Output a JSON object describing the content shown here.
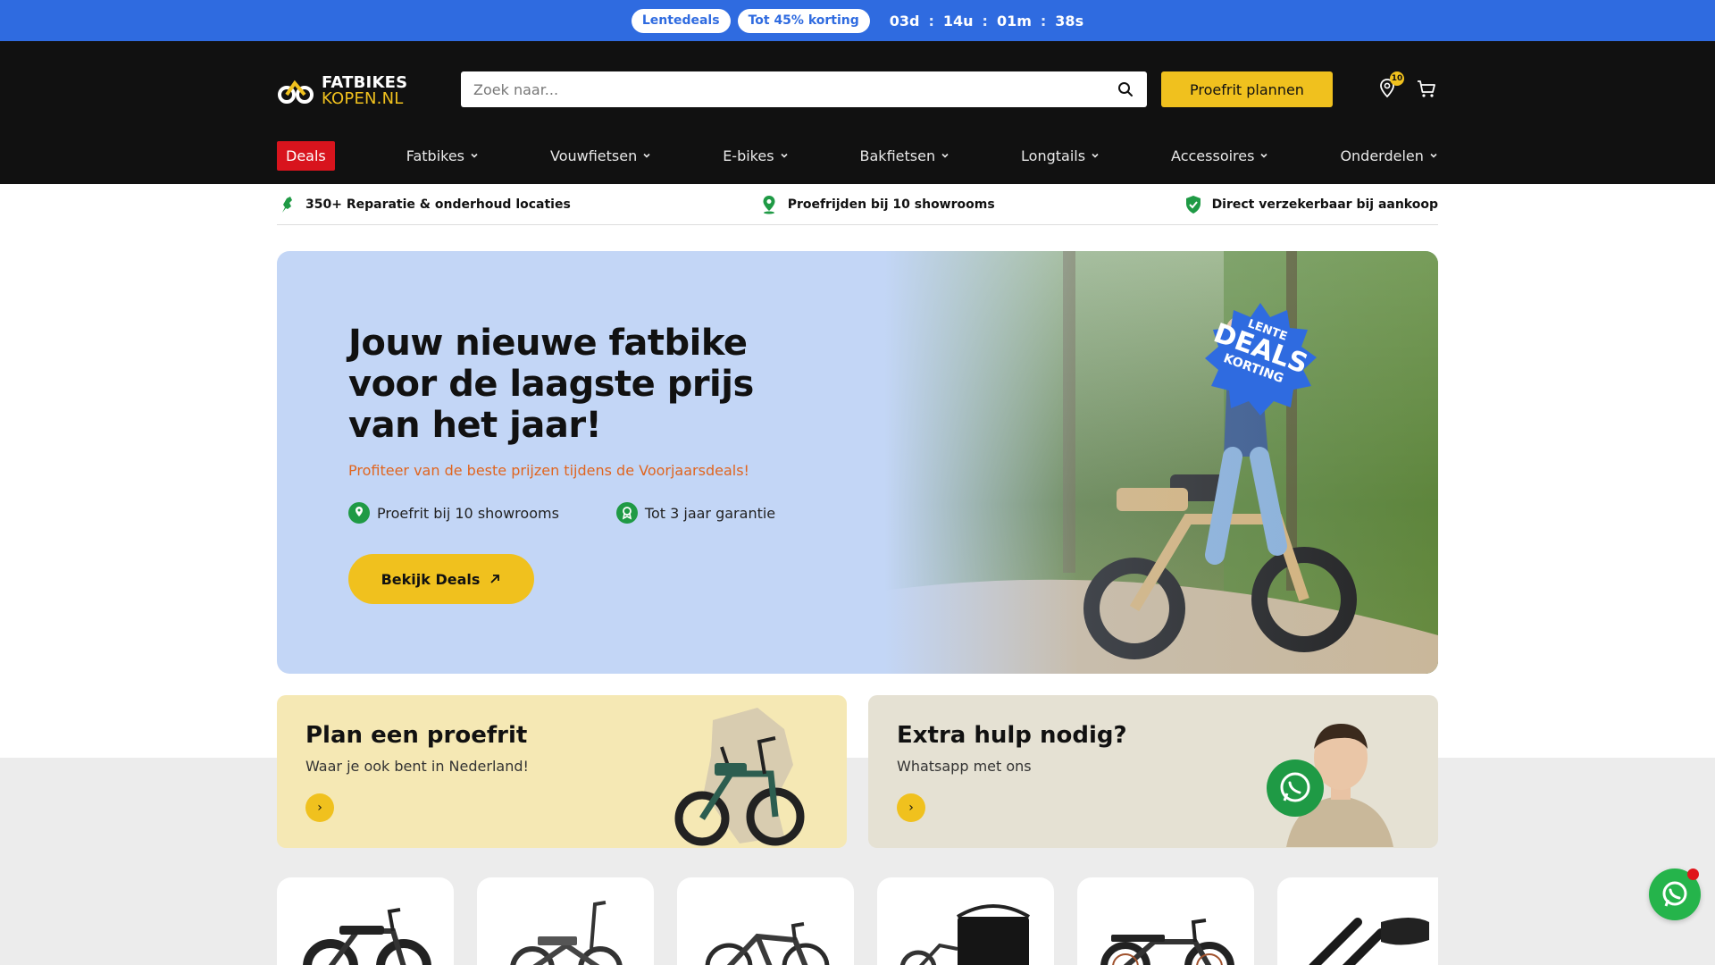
{
  "promo": {
    "pill1": "Lentedeals",
    "pill2": "Tot 45% korting",
    "days": "03d",
    "hours": "14u",
    "minutes": "01m",
    "seconds": "38s",
    "sep": ":"
  },
  "header": {
    "logo_line1": "FATBIKES",
    "logo_line2": "KOPEN.NL",
    "search_placeholder": "Zoek naar...",
    "cta": "Proefrit plannen",
    "location_badge": "10"
  },
  "nav": {
    "deals": "Deals",
    "items": [
      "Fatbikes",
      "Vouwfietsen",
      "E-bikes",
      "Bakfietsen",
      "Longtails",
      "Accessoires",
      "Onderdelen"
    ]
  },
  "usp": {
    "items": [
      "350+ Reparatie & onderhoud locaties",
      "Proefrijden bij 10 showrooms",
      "Direct verzekerbaar bij aankoop"
    ]
  },
  "hero": {
    "title": "Jouw nieuwe fatbike voor de laagste prijs van het jaar!",
    "subtitle": "Profiteer van de beste prijzen tijdens de Voorjaarsdeals!",
    "usp1": "Proefrit bij 10 showrooms",
    "usp2": "Tot 3 jaar garantie",
    "button": "Bekijk Deals",
    "sticker_line1": "LENTE",
    "sticker_line2": "DEALS",
    "sticker_line3": "KORTING"
  },
  "cards": [
    {
      "title": "Plan een proefrit",
      "subtitle": "Waar je ook bent in Nederland!",
      "arrow": "›"
    },
    {
      "title": "Extra hulp nodig?",
      "subtitle": "Whatsapp met ons",
      "arrow": "›"
    }
  ],
  "colors": {
    "promo_bar": "#2f6be0",
    "header": "#111111",
    "accent_yellow": "#f0c11e",
    "deals_red": "#d8141d",
    "hero_bg": "#c3d6f6",
    "subtitle_orange": "#e0651f",
    "whatsapp_green": "#25b44b"
  }
}
